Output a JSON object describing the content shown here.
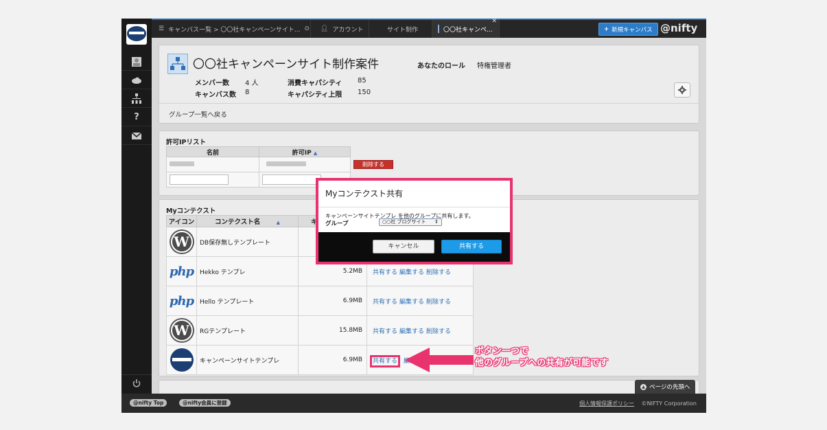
{
  "topbar": {
    "breadcrumb": "キャンバス一覧 > 〇〇社キャンペーンサイト...",
    "account_tab": "アカウント",
    "site_tab": "サイト制作",
    "active_tab": "〇〇社キャンペ...",
    "new_canvas_button": "新規キャンバス",
    "brand": "@nifty"
  },
  "group": {
    "title": "〇〇社キャンペーンサイト制作案件",
    "role_label": "あなたのロール",
    "role_value": "特権管理者",
    "members_label": "メンバー数",
    "members_value": "4 人",
    "canvas_label": "キャンバス数",
    "canvas_value": "8",
    "capacity_used_label": "消費キャパシティ",
    "capacity_used_value": "85",
    "capacity_limit_label": "キャパシティ上限",
    "capacity_limit_value": "150",
    "back_link": "グループ一覧へ戻る"
  },
  "ip_list": {
    "title": "許可IPリスト",
    "col_name": "名前",
    "col_ip": "許可IP",
    "delete_button": "削除する"
  },
  "contexts": {
    "title": "Myコンテクスト",
    "col_icon": "アイコン",
    "col_name": "コンテクスト名",
    "col_cap": "キ",
    "rows": [
      {
        "name": "DB保存無しテンプレート",
        "size": "",
        "icon": "wordpress-icon"
      },
      {
        "name": "Hekko テンプレ",
        "size": "5.2MB",
        "icon": "php-icon"
      },
      {
        "name": "Hello テンプレート",
        "size": "6.9MB",
        "icon": "php-icon"
      },
      {
        "name": "RGテンプレート",
        "size": "15.8MB",
        "icon": "wordpress-icon"
      },
      {
        "name": "キャンペーンサイトテンプレ",
        "size": "6.9MB",
        "icon": "canvas-logo-icon"
      }
    ],
    "action_share": "共有する",
    "action_edit": "編集する",
    "action_delete": "削除する",
    "last_row_partial": "編"
  },
  "modal": {
    "title": "Myコンテクスト共有",
    "message": "キャンペーンサイトテンプレ を他のグループに共有します。",
    "group_label": "グループ",
    "group_select": "○○社 ブログサイト",
    "cancel_button": "キャンセル",
    "share_button": "共有する"
  },
  "callout": {
    "line1": "ボタン一つで",
    "line2": "他のグループへの共有が可能です"
  },
  "scroll_top": "ページの先頭へ",
  "footer": {
    "pill1": "@nifty Top",
    "pill2": "@nifty会員に登録",
    "policy": "個人情報保護ポリシー",
    "copyright": "©NIFTY Corporation"
  },
  "colors": {
    "accent_pink": "#e8336e",
    "primary_blue": "#1e9be8",
    "danger_red": "#c8302b",
    "link_blue": "#2f6fb5"
  }
}
